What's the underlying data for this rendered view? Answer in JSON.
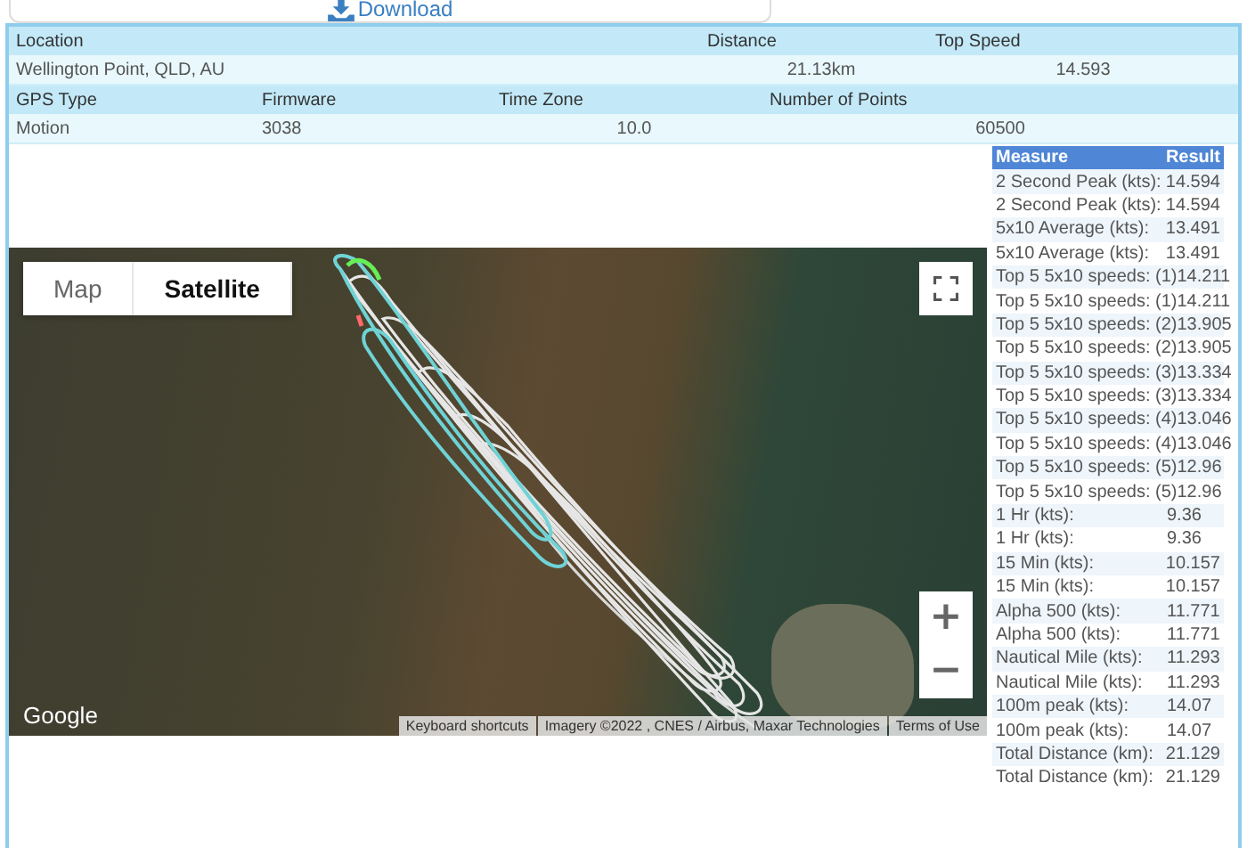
{
  "download_button": {
    "label": "Download"
  },
  "info": [
    {
      "headers": [
        "Location",
        "Distance",
        "Top Speed"
      ],
      "values": [
        {
          "text": "Wellington Point, QLD, AU",
          "kind": "text"
        },
        {
          "text": "21.13km",
          "kind": "number"
        },
        {
          "text": "14.593",
          "kind": "number"
        }
      ]
    },
    {
      "headers": [
        "GPS Type",
        "Firmware",
        "Time Zone",
        "Number of Points"
      ],
      "values": [
        {
          "text": "Motion",
          "kind": "text"
        },
        {
          "text": "3038",
          "kind": "text"
        },
        {
          "text": "10.0",
          "kind": "number"
        },
        {
          "text": "60500",
          "kind": "number"
        }
      ]
    }
  ],
  "map": {
    "type_buttons": [
      {
        "label": "Map",
        "selected": false
      },
      {
        "label": "Satellite",
        "selected": true
      }
    ],
    "zoom_in": "+",
    "zoom_out": "−",
    "logo": "Google",
    "attribution": [
      "Keyboard shortcuts",
      "Imagery ©2022 , CNES / Airbus, Maxar Technologies",
      "Terms of Use"
    ]
  },
  "results": {
    "columns": [
      "Measure",
      "Result"
    ],
    "rows": [
      {
        "measure": "2 Second Peak (kts):",
        "result": "14.594"
      },
      {
        "measure": "2 Second Peak (kts):",
        "result": "14.594"
      },
      {
        "measure": "5x10 Average (kts):",
        "result": "13.491"
      },
      {
        "measure": "5x10 Average (kts):",
        "result": "13.491"
      },
      {
        "measure": "Top 5 5x10 speeds: (1)",
        "result": "14.211"
      },
      {
        "measure": "Top 5 5x10 speeds: (1)",
        "result": "14.211"
      },
      {
        "measure": "Top 5 5x10 speeds: (2)",
        "result": "13.905"
      },
      {
        "measure": "Top 5 5x10 speeds: (2)",
        "result": "13.905"
      },
      {
        "measure": "Top 5 5x10 speeds: (3)",
        "result": "13.334"
      },
      {
        "measure": "Top 5 5x10 speeds: (3)",
        "result": "13.334"
      },
      {
        "measure": "Top 5 5x10 speeds: (4)",
        "result": "13.046"
      },
      {
        "measure": "Top 5 5x10 speeds: (4)",
        "result": "13.046"
      },
      {
        "measure": "Top 5 5x10 speeds: (5)",
        "result": "12.96"
      },
      {
        "measure": "Top 5 5x10 speeds: (5)",
        "result": "12.96"
      },
      {
        "measure": "1 Hr (kts):",
        "result": "9.36"
      },
      {
        "measure": "1 Hr (kts):",
        "result": "9.36"
      },
      {
        "measure": "15 Min (kts):",
        "result": "10.157"
      },
      {
        "measure": "15 Min (kts):",
        "result": "10.157"
      },
      {
        "measure": "Alpha 500 (kts):",
        "result": "11.771"
      },
      {
        "measure": "Alpha 500 (kts):",
        "result": "11.771"
      },
      {
        "measure": "Nautical Mile (kts):",
        "result": "11.293"
      },
      {
        "measure": "Nautical Mile (kts):",
        "result": "11.293"
      },
      {
        "measure": "100m peak (kts):",
        "result": "14.07"
      },
      {
        "measure": "100m peak (kts):",
        "result": "14.07"
      },
      {
        "measure": "Total Distance (km):",
        "result": "21.129"
      },
      {
        "measure": "Total Distance (km):",
        "result": "21.129"
      }
    ]
  }
}
